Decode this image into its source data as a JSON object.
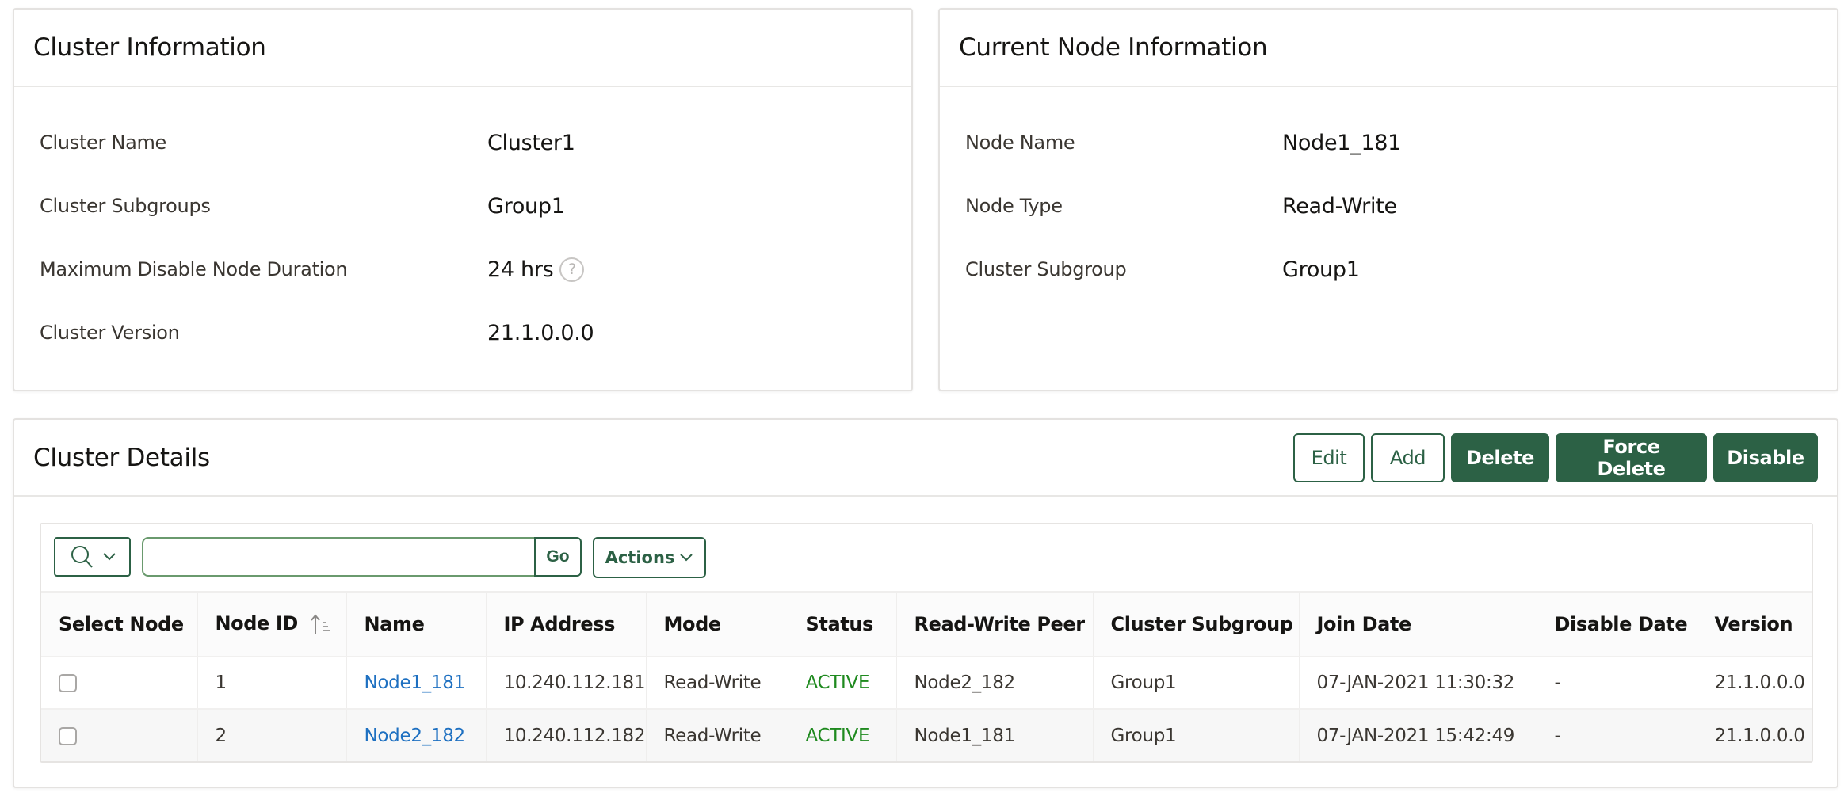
{
  "cluster_info": {
    "title": "Cluster Information",
    "fields": [
      {
        "label": "Cluster Name",
        "value": "Cluster1"
      },
      {
        "label": "Cluster Subgroups",
        "value": "Group1"
      },
      {
        "label": "Maximum Disable Node Duration",
        "value": "24 hrs",
        "help_icon": "question-circle-icon"
      },
      {
        "label": "Cluster Version",
        "value": "21.1.0.0.0"
      }
    ]
  },
  "node_info": {
    "title": "Current Node Information",
    "fields": [
      {
        "label": "Node Name",
        "value": "Node1_181"
      },
      {
        "label": "Node Type",
        "value": "Read-Write"
      },
      {
        "label": "Cluster Subgroup",
        "value": "Group1"
      }
    ]
  },
  "cluster_details": {
    "title": "Cluster Details",
    "buttons": {
      "edit": "Edit",
      "add": "Add",
      "delete": "Delete",
      "force_delete": "Force Delete",
      "disable": "Disable"
    },
    "toolbar": {
      "search_icon": "search-icon",
      "search_value": "",
      "search_placeholder": "",
      "go_label": "Go",
      "actions_label": "Actions"
    },
    "columns": [
      "Select Node",
      "Node ID",
      "Name",
      "IP Address",
      "Mode",
      "Status",
      "Read-Write Peer",
      "Cluster Subgroup",
      "Join Date",
      "Disable Date",
      "Version"
    ],
    "sort": {
      "column": "Node ID",
      "direction": "ascending"
    },
    "rows": [
      {
        "node_id": "1",
        "name": "Node1_181",
        "ip": "10.240.112.181",
        "mode": "Read-Write",
        "status": "ACTIVE",
        "peer": "Node2_182",
        "subgroup": "Group1",
        "join_date": "07-JAN-2021 11:30:32",
        "disable_date": "-",
        "version": "21.1.0.0.0",
        "selected": false
      },
      {
        "node_id": "2",
        "name": "Node2_182",
        "ip": "10.240.112.182",
        "mode": "Read-Write",
        "status": "ACTIVE",
        "peer": "Node1_181",
        "subgroup": "Group1",
        "join_date": "07-JAN-2021 15:42:49",
        "disable_date": "-",
        "version": "21.1.0.0.0",
        "selected": false
      }
    ]
  },
  "colors": {
    "primary_green": "#2c6145",
    "link_blue": "#1e70c1",
    "status_active": "#1f8a1f"
  }
}
